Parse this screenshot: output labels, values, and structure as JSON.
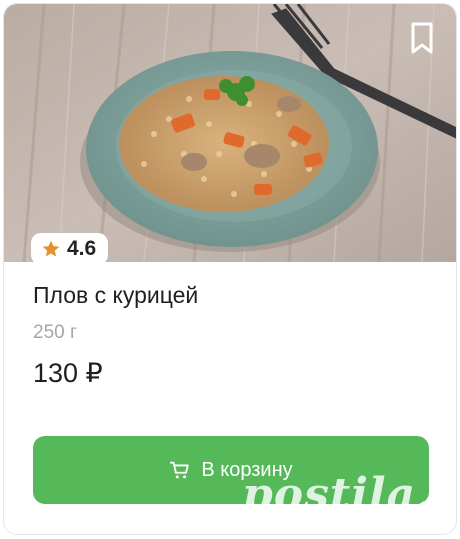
{
  "product": {
    "title": "Плов с курицей",
    "weight": "250 г",
    "price": "130 ₽",
    "rating": "4.6"
  },
  "actions": {
    "add_to_cart_label": "В корзину"
  },
  "icons": {
    "bookmark": "bookmark-icon",
    "star": "star-icon",
    "cart": "cart-icon"
  },
  "colors": {
    "accent_green": "#55b959",
    "rating_star": "#e6902b",
    "muted_text": "#a3a7ad"
  },
  "watermark": "postila.ru"
}
